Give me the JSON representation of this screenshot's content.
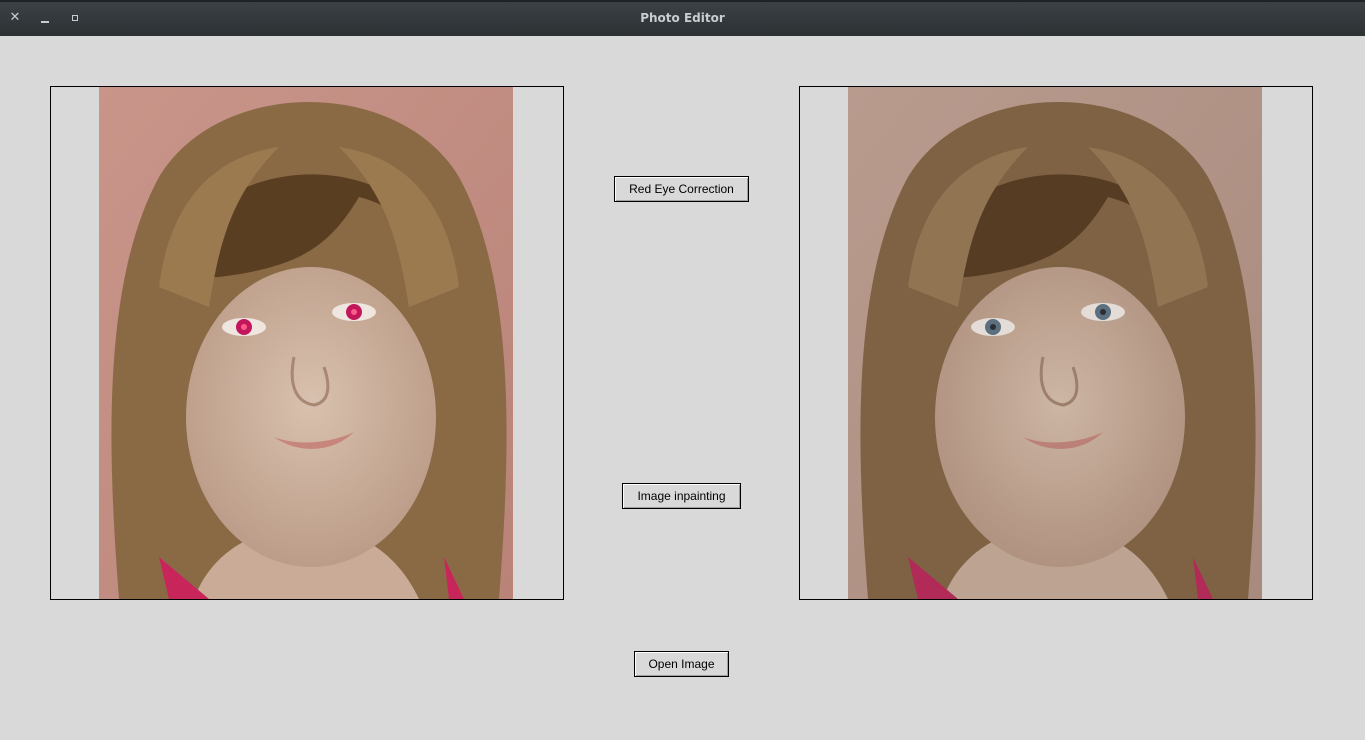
{
  "window": {
    "title": "Photo Editor",
    "controls": {
      "close_glyph": "✕"
    }
  },
  "buttons": {
    "red_eye": "Red Eye Correction",
    "inpaint": "Image inpainting",
    "open": "Open Image"
  },
  "images": {
    "original": {
      "red_eyes": true
    },
    "result": {
      "red_eyes": false
    }
  },
  "colors": {
    "background": "#d9d9d9",
    "titlebar": "#2f3437",
    "red_eye": "#c2185b",
    "corrected_eye": "#5c6f7e"
  }
}
